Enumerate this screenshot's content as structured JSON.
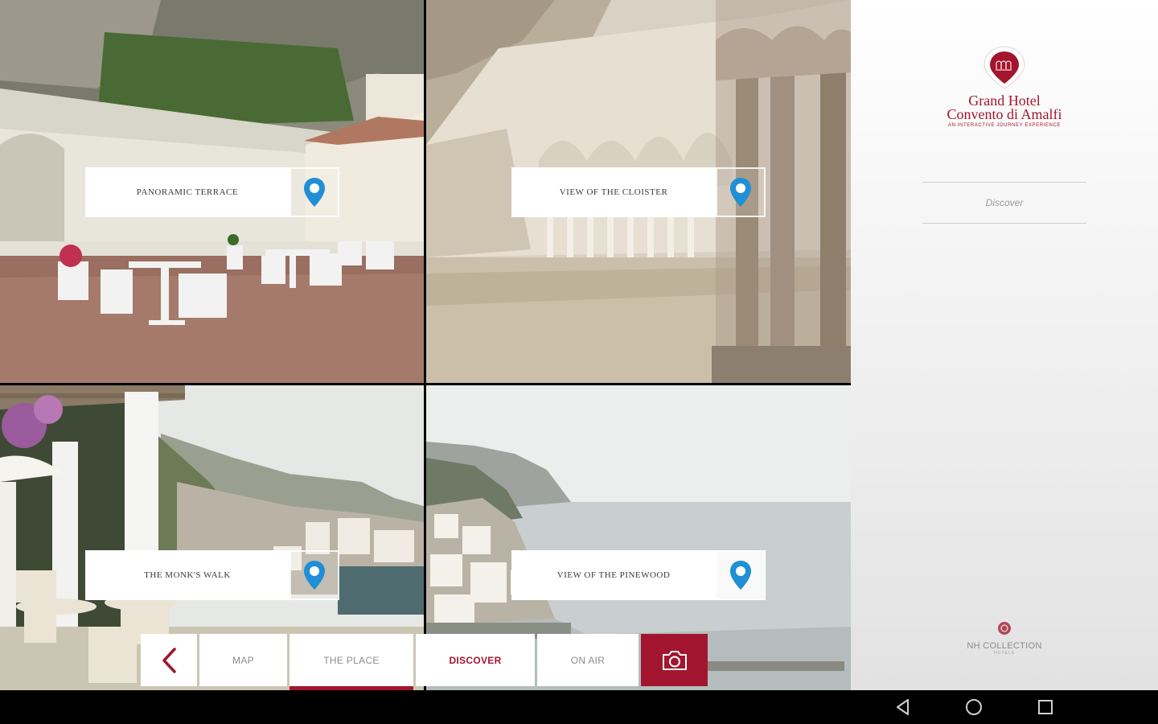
{
  "tiles": [
    {
      "label": "PANORAMIC TERRACE"
    },
    {
      "label": "VIEW OF THE CLOISTER"
    },
    {
      "label": "THE MONK'S WALK"
    },
    {
      "label": "VIEW OF THE PINEWOOD"
    }
  ],
  "brand": {
    "title_line1": "Grand Hotel",
    "title_line2": "Convento di Amalfi",
    "subtitle": "AN INTERACTIVE JOURNEY EXPERIENCE",
    "discover_link": "Discover",
    "footer_brand": "NH COLLECTION",
    "footer_sub": "HOTELS"
  },
  "nav": {
    "map": "MAP",
    "the_place": "THE PLACE",
    "discover": "DISCOVER",
    "on_air": "ON AIR"
  },
  "colors": {
    "accent": "#a3152e",
    "pin": "#1f8fd6"
  }
}
